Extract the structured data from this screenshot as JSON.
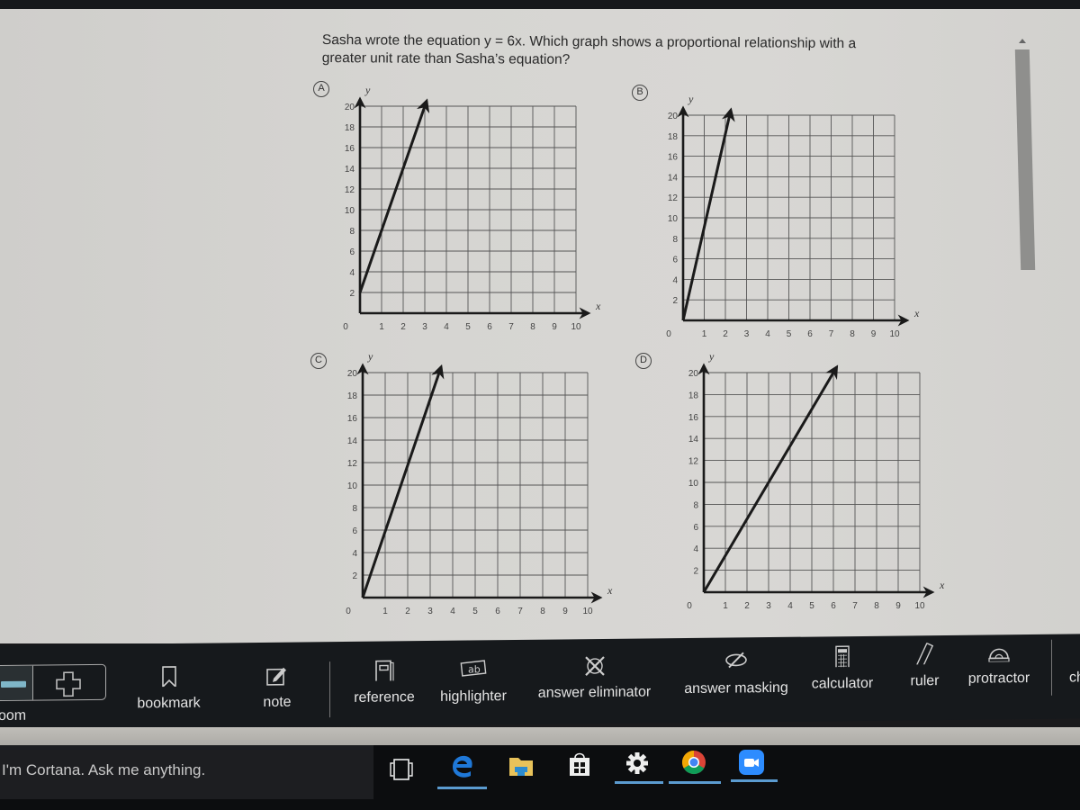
{
  "question": {
    "text": "Sasha wrote the equation y = 6x. Which graph shows a proportional relationship with a greater unit rate than Sasha’s equation?"
  },
  "chart_data": [
    {
      "type": "line",
      "option": "A",
      "xlabel": "x",
      "ylabel": "y",
      "xlim": [
        0,
        10
      ],
      "ylim": [
        0,
        20
      ],
      "x_ticks": [
        "0",
        "1",
        "2",
        "3",
        "4",
        "5",
        "6",
        "7",
        "8",
        "9",
        "10"
      ],
      "y_ticks": [
        "2",
        "4",
        "6",
        "8",
        "10",
        "12",
        "14",
        "16",
        "18",
        "20"
      ],
      "grid": true,
      "series": [
        {
          "name": "line A",
          "x": [
            0,
            3
          ],
          "y": [
            2,
            20
          ]
        }
      ]
    },
    {
      "type": "line",
      "option": "B",
      "xlabel": "x",
      "ylabel": "y",
      "xlim": [
        0,
        10
      ],
      "ylim": [
        0,
        20
      ],
      "x_ticks": [
        "0",
        "1",
        "2",
        "3",
        "4",
        "5",
        "6",
        "7",
        "8",
        "9",
        "10"
      ],
      "y_ticks": [
        "2",
        "4",
        "6",
        "8",
        "10",
        "12",
        "14",
        "16",
        "18",
        "20"
      ],
      "grid": true,
      "series": [
        {
          "name": "line B",
          "x": [
            0,
            2.2
          ],
          "y": [
            0,
            20
          ]
        }
      ]
    },
    {
      "type": "line",
      "option": "C",
      "xlabel": "x",
      "ylabel": "y",
      "xlim": [
        0,
        10
      ],
      "ylim": [
        0,
        20
      ],
      "x_ticks": [
        "0",
        "1",
        "2",
        "3",
        "4",
        "5",
        "6",
        "7",
        "8",
        "9",
        "10"
      ],
      "y_ticks": [
        "2",
        "4",
        "6",
        "8",
        "10",
        "12",
        "14",
        "16",
        "18",
        "20"
      ],
      "grid": true,
      "series": [
        {
          "name": "line C",
          "x": [
            0,
            3.4
          ],
          "y": [
            0,
            20
          ]
        }
      ]
    },
    {
      "type": "line",
      "option": "D",
      "xlabel": "x",
      "ylabel": "y",
      "xlim": [
        0,
        10
      ],
      "ylim": [
        0,
        20
      ],
      "x_ticks": [
        "0",
        "1",
        "2",
        "3",
        "4",
        "5",
        "6",
        "7",
        "8",
        "9",
        "10"
      ],
      "y_ticks": [
        "2",
        "4",
        "6",
        "8",
        "10",
        "12",
        "14",
        "16",
        "18",
        "20"
      ],
      "grid": true,
      "series": [
        {
          "name": "line D",
          "x": [
            0,
            6
          ],
          "y": [
            0,
            20
          ]
        }
      ]
    }
  ],
  "toolbar": {
    "zoom_label": "zoom",
    "zoom_label_visible": "oom",
    "items": [
      {
        "id": "bookmark",
        "label": "bookmark",
        "icon": "bookmark-icon"
      },
      {
        "id": "note",
        "label": "note",
        "icon": "note-icon"
      },
      {
        "id": "reference",
        "label": "reference",
        "icon": "reference-icon"
      },
      {
        "id": "highlighter",
        "label": "highlighter",
        "icon": "highlighter-icon"
      },
      {
        "id": "answer-eliminator",
        "label": "answer eliminator",
        "icon": "answer-eliminator-icon"
      },
      {
        "id": "answer-masking",
        "label": "answer masking",
        "icon": "answer-masking-icon"
      },
      {
        "id": "calculator",
        "label": "calculator",
        "icon": "calculator-icon"
      },
      {
        "id": "ruler",
        "label": "ruler",
        "icon": "ruler-icon"
      },
      {
        "id": "protractor",
        "label": "protractor",
        "icon": "protractor-icon"
      },
      {
        "id": "ch",
        "label": "ch",
        "icon": ""
      }
    ]
  },
  "taskbar": {
    "cortana_placeholder": "I'm Cortana. Ask me anything.",
    "apps": [
      {
        "name": "task-view",
        "icon": "task-view-icon",
        "active": false
      },
      {
        "name": "edge",
        "icon": "edge-icon",
        "active": true
      },
      {
        "name": "file-explorer",
        "icon": "folder-icon",
        "active": false
      },
      {
        "name": "store",
        "icon": "store-icon",
        "active": false
      },
      {
        "name": "settings",
        "icon": "gear-icon",
        "active": true
      },
      {
        "name": "chrome",
        "icon": "chrome-icon",
        "active": true
      },
      {
        "name": "zoom",
        "icon": "zoom-video-icon",
        "active": true
      }
    ],
    "accent": "#5b9bd0"
  }
}
